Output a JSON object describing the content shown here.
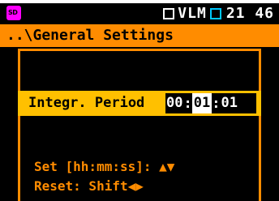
{
  "status": {
    "indicator": "VLM",
    "time": "21 46",
    "card_icon_label": "SD"
  },
  "title": "..\\General Settings",
  "row": {
    "label": "Integr. Period",
    "hours": "00",
    "minutes": "01",
    "seconds": "01",
    "separator": ":"
  },
  "hints": {
    "set_label": "Set [hh:mm:ss]:",
    "set_arrows": "▲▼",
    "reset_label": "Reset: Shift",
    "reset_arrows": "◀▶"
  },
  "colors": {
    "background": "#000000",
    "accent": "#ff8c00",
    "row_highlight": "#ffc000",
    "sd_icon": "#ff00ff",
    "battery_outline": "#00c8ff"
  }
}
